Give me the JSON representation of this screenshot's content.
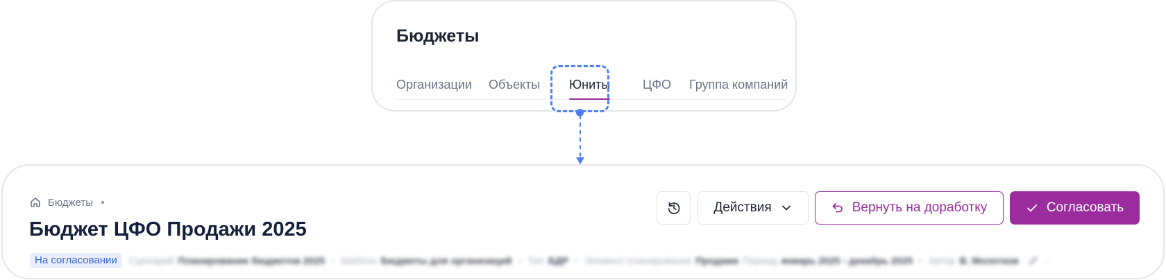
{
  "top_card": {
    "title": "Бюджеты",
    "tabs": [
      {
        "label": "Организации",
        "active": false
      },
      {
        "label": "Объекты",
        "active": false
      },
      {
        "label": "Юниты",
        "active": true
      },
      {
        "label": "ЦФО",
        "active": false
      },
      {
        "label": "Группа компаний",
        "active": false
      }
    ]
  },
  "header": {
    "breadcrumb": {
      "icon": "home-icon",
      "label": "Бюджеты"
    },
    "title": "Бюджет ЦФО Продажи 2025",
    "status": "На согласовании",
    "meta": [
      {
        "label": "Сценарий",
        "value": "Планирование бюджетов 2025"
      },
      {
        "label": "Шаблон",
        "value": "Бюджеты для организаций"
      },
      {
        "label": "Тип",
        "value": "БДР"
      },
      {
        "label": "Элемент планирования",
        "value": "Продажи"
      },
      {
        "label": "Период",
        "value": "январь 2025 - декабрь 2025"
      },
      {
        "label": "Автор",
        "value": "В. Молотков"
      }
    ],
    "more": "···"
  },
  "actions": {
    "history_icon": "history-icon",
    "actions_label": "Действия",
    "return_label": "Вернуть на доработку",
    "approve_label": "Согласовать"
  },
  "colors": {
    "accent": "#9a2c9e",
    "callout": "#4f7ef0",
    "status_text": "#3a64d8",
    "status_bg": "#e8eefc",
    "title": "#14213d"
  }
}
